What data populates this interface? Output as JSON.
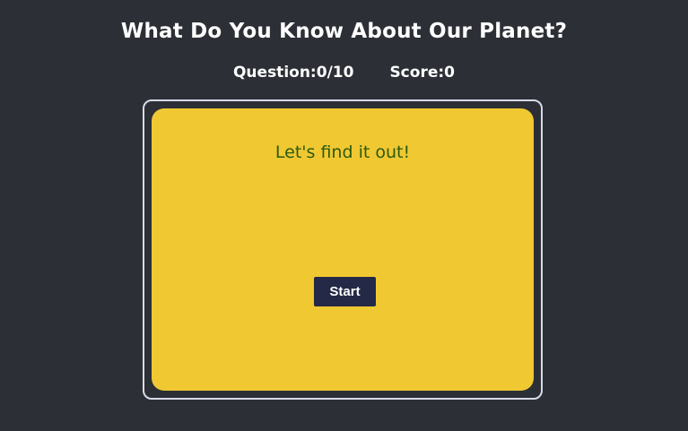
{
  "header": {
    "title": "What Do You Know About Our Planet?"
  },
  "stats": {
    "question_label": "Question:",
    "question_value": "0/10",
    "score_label": "Score:",
    "score_value": "0"
  },
  "card": {
    "prompt": "Let's find it out!",
    "start_label": "Start"
  },
  "colors": {
    "background": "#2c2f35",
    "card": "#f0c832",
    "prompt_text": "#2b5a10",
    "button": "#232946",
    "frame_border": "#d7dbe8"
  }
}
